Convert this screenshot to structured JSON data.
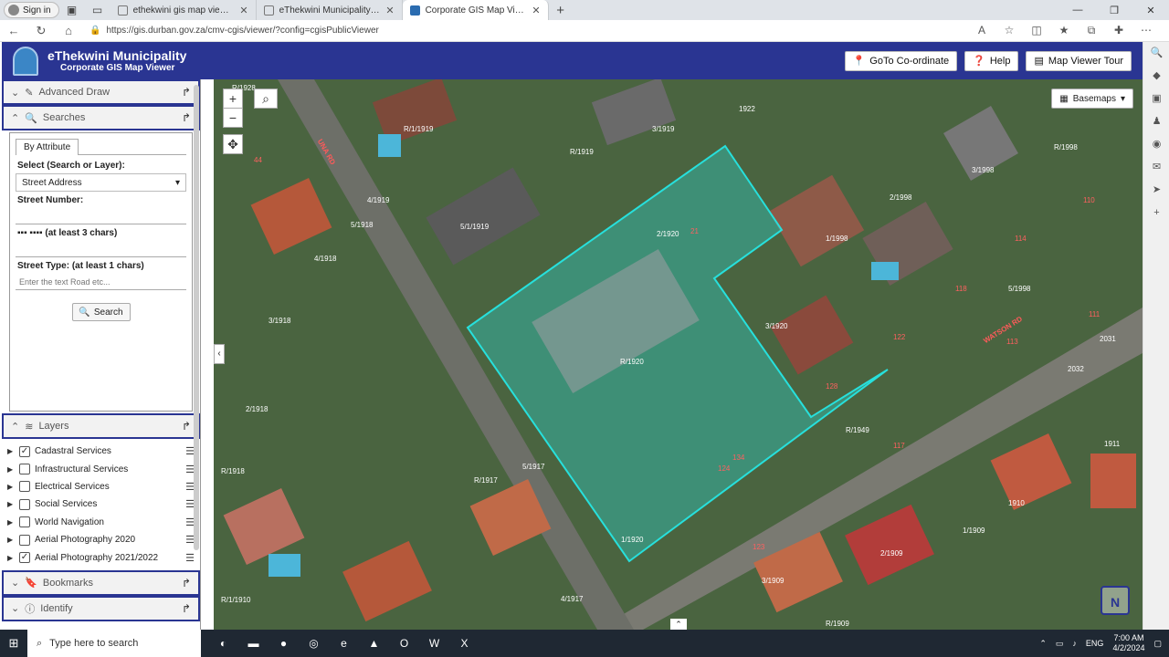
{
  "browser": {
    "signin": "Sign in",
    "tabs": [
      {
        "label": "ethekwini gis map viewer - Searc",
        "active": false
      },
      {
        "label": "eThekwini Municipality GIS Web",
        "active": false
      },
      {
        "label": "Corporate GIS Map Viewer",
        "active": true
      }
    ],
    "url": "https://gis.durban.gov.za/cmv-cgis/viewer/?config=cgisPublicViewer"
  },
  "header": {
    "title": "eThekwini Municipality",
    "subtitle": "Corporate GIS Map Viewer",
    "buttons": {
      "goto": "GoTo Co-ordinate",
      "help": "Help",
      "tour": "Map Viewer Tour"
    },
    "color": "#2a3592"
  },
  "panel": {
    "advanced_draw": "Advanced Draw",
    "searches": "Searches",
    "search_tab": "By Attribute",
    "select_label": "Select (Search or Layer):",
    "select_value": "Street Address",
    "street_number_label": "Street Number:",
    "street_name_suffix": "(at least 3 chars)",
    "street_type_label": "Street Type: (at least 1 chars)",
    "street_type_placeholder": "Enter the text Road etc...",
    "search_button": "Search",
    "layers_title": "Layers",
    "layers": [
      {
        "name": "Cadastral Services",
        "checked": true
      },
      {
        "name": "Infrastructural Services",
        "checked": false
      },
      {
        "name": "Electrical Services",
        "checked": false
      },
      {
        "name": "Social Services",
        "checked": false
      },
      {
        "name": "World Navigation",
        "checked": false
      },
      {
        "name": "Aerial Photography 2020",
        "checked": false
      },
      {
        "name": "Aerial Photography 2021/2022",
        "checked": true
      }
    ],
    "bookmarks": "Bookmarks",
    "identify": "Identify"
  },
  "map": {
    "basemaps": "Basemaps",
    "highlight_color": "#27e0dc",
    "parcel_labels": [
      "R/1928",
      "R/1919",
      "3/1919",
      "1922",
      "R/1998",
      "3/1998",
      "2/1998",
      "1/1998",
      "5/1998",
      "R/1920",
      "2/1920",
      "1/1920",
      "3/1920",
      "R/1949",
      "5/1917",
      "R/1917",
      "4/1919",
      "5/1918",
      "4/1918",
      "3/1918",
      "2/1918",
      "R/1918",
      "5/1/1919",
      "R/1/1919",
      "1/1909",
      "2/1909",
      "3/1909",
      "1910",
      "1911",
      "2031",
      "2032",
      "R/1909",
      "4/1917"
    ],
    "street_labels": [
      "UNA RD",
      "WATSON RD"
    ],
    "house_numbers": [
      "21",
      "134",
      "124",
      "128",
      "122",
      "123",
      "113",
      "114",
      "118",
      "110",
      "111",
      "117",
      "44"
    ],
    "scale_label": "R/1/1910"
  },
  "taskbar": {
    "search_placeholder": "Type here to search",
    "lang": "ENG",
    "time": "7:00 AM",
    "date": "4/2/2024"
  }
}
